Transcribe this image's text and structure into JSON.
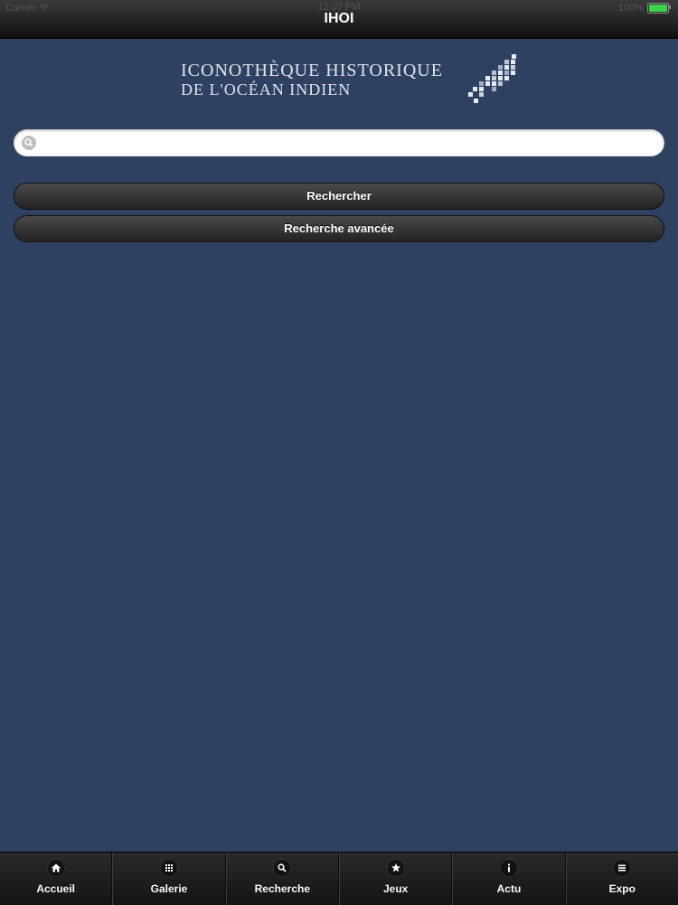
{
  "status_bar": {
    "carrier": "Carrier",
    "time": "12:07 PM",
    "battery_text": "100%",
    "battery_level": 1.0
  },
  "header": {
    "title": "IHOI"
  },
  "logo": {
    "line1": "ICONOTHÈQUE HISTORIQUE",
    "line2": "DE L'OCÉAN INDIEN"
  },
  "search": {
    "value": "",
    "placeholder": ""
  },
  "buttons": {
    "search_label": "Rechercher",
    "advanced_label": "Recherche avancée"
  },
  "tabbar": {
    "tabs": [
      {
        "label": "Accueil",
        "icon": "home-icon"
      },
      {
        "label": "Galerie",
        "icon": "grid-icon"
      },
      {
        "label": "Recherche",
        "icon": "search-icon"
      },
      {
        "label": "Jeux",
        "icon": "star-icon"
      },
      {
        "label": "Actu",
        "icon": "info-icon"
      },
      {
        "label": "Expo",
        "icon": "menu-icon"
      }
    ]
  },
  "colors": {
    "background": "#2f4161",
    "bar": "#1a1a1a",
    "battery": "#3cd44a"
  }
}
